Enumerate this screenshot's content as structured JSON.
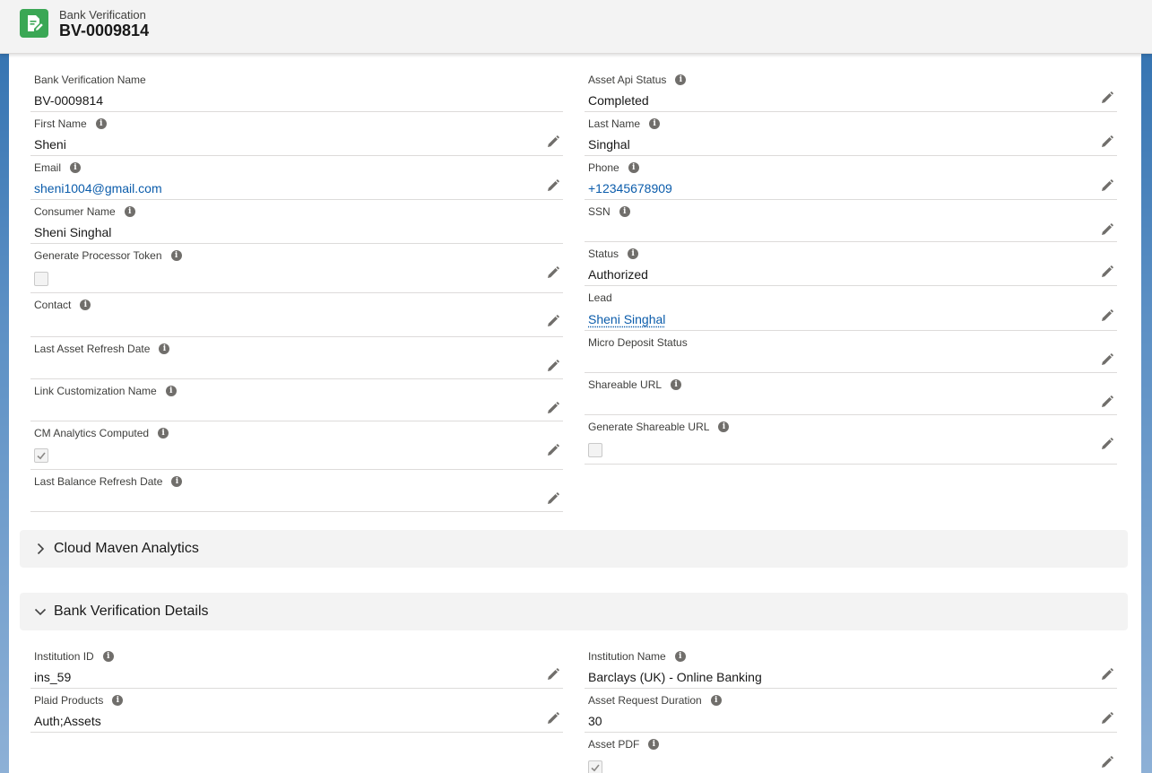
{
  "header": {
    "object_type": "Bank Verification",
    "record_name": "BV-0009814"
  },
  "fields": {
    "bank_verification_name": {
      "label": "Bank Verification Name",
      "value": "BV-0009814"
    },
    "asset_api_status": {
      "label": "Asset Api Status",
      "value": "Completed"
    },
    "first_name": {
      "label": "First Name",
      "value": "Sheni"
    },
    "last_name": {
      "label": "Last Name",
      "value": "Singhal"
    },
    "email": {
      "label": "Email",
      "value": "sheni1004@gmail.com"
    },
    "phone": {
      "label": "Phone",
      "value": "+12345678909"
    },
    "consumer_name": {
      "label": "Consumer Name",
      "value": "Sheni Singhal"
    },
    "ssn": {
      "label": "SSN",
      "value": ""
    },
    "generate_processor_token": {
      "label": "Generate Processor Token",
      "checked": false
    },
    "status": {
      "label": "Status",
      "value": "Authorized"
    },
    "contact": {
      "label": "Contact",
      "value": ""
    },
    "lead": {
      "label": "Lead",
      "value": "Sheni Singhal"
    },
    "last_asset_refresh_date": {
      "label": "Last Asset Refresh Date",
      "value": ""
    },
    "micro_deposit_status": {
      "label": "Micro Deposit Status",
      "value": ""
    },
    "link_customization_name": {
      "label": "Link Customization Name",
      "value": ""
    },
    "shareable_url": {
      "label": "Shareable URL",
      "value": ""
    },
    "cm_analytics_computed": {
      "label": "CM Analytics Computed",
      "checked": true
    },
    "generate_shareable_url": {
      "label": "Generate Shareable URL",
      "checked": false
    },
    "last_balance_refresh_date": {
      "label": "Last Balance Refresh Date",
      "value": ""
    }
  },
  "sections": {
    "cloud_maven": {
      "title": "Cloud Maven Analytics",
      "expanded": false
    },
    "bank_details": {
      "title": "Bank Verification Details",
      "expanded": true
    }
  },
  "details": {
    "institution_id": {
      "label": "Institution ID",
      "value": "ins_59"
    },
    "institution_name": {
      "label": "Institution Name",
      "value": "Barclays (UK) - Online Banking"
    },
    "plaid_products": {
      "label": "Plaid Products",
      "value": "Auth;Assets"
    },
    "asset_request_duration": {
      "label": "Asset Request Duration",
      "value": "30"
    },
    "asset_pdf": {
      "label": "Asset PDF",
      "checked": true
    }
  },
  "icons": {
    "object": "document-edit-icon",
    "info": "info-icon",
    "edit": "pencil-icon",
    "expand": "chevron-right-icon",
    "collapse": "chevron-down-icon"
  },
  "colors": {
    "object_icon": "#3ba755",
    "link": "#0b5cab",
    "header_bg": "#f3f3f3"
  }
}
